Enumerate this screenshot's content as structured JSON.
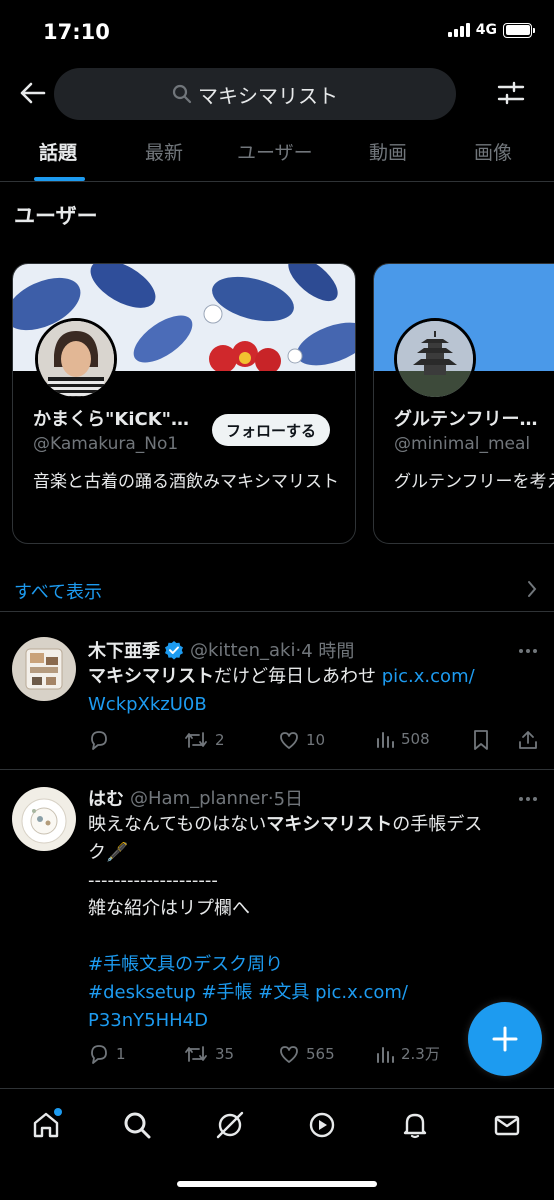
{
  "status_bar": {
    "time": "17:10",
    "network": "4G"
  },
  "header": {
    "search_query": "マキシマリスト"
  },
  "tabs": [
    {
      "label": "話題",
      "active": true
    },
    {
      "label": "最新",
      "active": false
    },
    {
      "label": "ユーザー",
      "active": false
    },
    {
      "label": "動画",
      "active": false
    },
    {
      "label": "画像",
      "active": false
    }
  ],
  "users_section": {
    "title": "ユーザー",
    "cards": [
      {
        "name": "かまくら\"KiCK\"…",
        "handle": "@Kamakura_No1",
        "bio": "音楽と古着の踊る酒飲みマキシマリスト",
        "follow_label": "フォローする"
      },
      {
        "name": "グルテンフリー…",
        "handle": "@minimal_meal",
        "bio": "グルテンフリーを考えるのが大変に"
      }
    ],
    "show_all_label": "すべて表示"
  },
  "tweets": [
    {
      "name": "木下亜季",
      "verified": true,
      "handle": "@kitten_aki",
      "time": "4 時間",
      "text_bold": "マキシマリスト",
      "text_rest": "だけど毎日しあわせ ",
      "link1": "pic.x.com/",
      "link2": "WckpXkzU0B",
      "stats": {
        "replies": "",
        "retweets": "2",
        "likes": "10",
        "views": "508"
      }
    },
    {
      "name": "はむ",
      "verified": false,
      "handle": "@Ham_planner",
      "time": "5日",
      "line1_pre": "映えなんてものはない",
      "line1_bold": "マキシマリスト",
      "line1_post": "の手帳デス",
      "line2": "ク🖋️",
      "line3": "--------------------",
      "line4": "雑な紹介はリプ欄へ",
      "hashtag_line1": "#手帳文具のデスク周り",
      "hashtag_line2_tags": "#desksetup #手帳 #文具",
      "hashtag_line2_link": " pic.x.com/",
      "link_tail": "P33nY5HH4D",
      "stats": {
        "replies": "1",
        "retweets": "35",
        "likes": "565",
        "views": "2.3万"
      }
    }
  ],
  "colors": {
    "accent": "#1d9bf0",
    "background": "#000000",
    "muted": "#71767b",
    "divider": "#2f3336"
  }
}
